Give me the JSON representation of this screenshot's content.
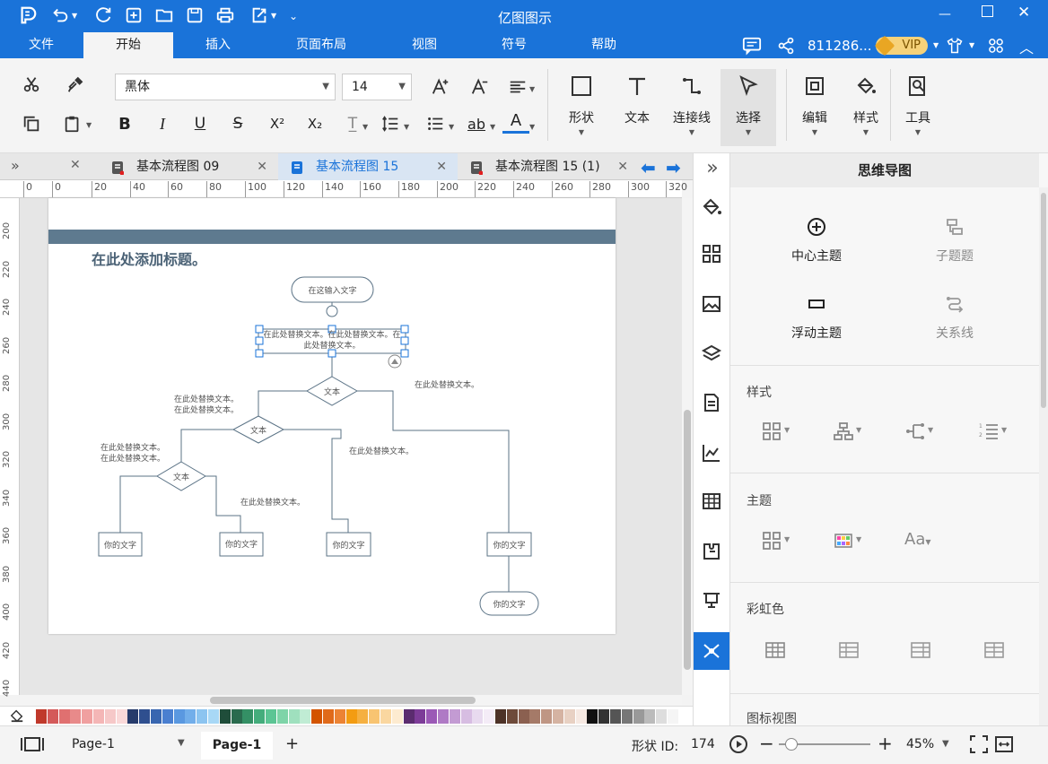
{
  "window": {
    "title": "亿图图示"
  },
  "menu": [
    "文件",
    "开始",
    "插入",
    "页面布局",
    "视图",
    "符号",
    "帮助"
  ],
  "user": {
    "id": "811286...",
    "vip": "VIP"
  },
  "ribbon": {
    "font": "黑体",
    "size": "14",
    "tools": {
      "shape": "形状",
      "text": "文本",
      "connector": "连接线",
      "select": "选择",
      "edit": "编辑",
      "style": "样式",
      "tool": "工具"
    }
  },
  "tabs": [
    {
      "label": "基本流程图 09",
      "active": false
    },
    {
      "label": "基本流程图 15",
      "active": true
    },
    {
      "label": "基本流程图 15 (1)",
      "active": false
    }
  ],
  "ruler": {
    "h": [
      "0",
      "0",
      "20",
      "40",
      "60",
      "80",
      "100",
      "120",
      "140",
      "160",
      "180",
      "200",
      "220",
      "240",
      "260",
      "280",
      "300",
      "320"
    ],
    "v": [
      "200",
      "220",
      "240",
      "260",
      "280",
      "300",
      "320",
      "340",
      "360",
      "380",
      "400",
      "420",
      "440"
    ]
  },
  "canvas": {
    "title": "在此处添加标题。",
    "start": "在这输入文字",
    "process": "在此处替换文本。在此处替换文本。在此处替换文本。",
    "decision": "文本",
    "note_right": "在此处替换文本。",
    "note_left1": "在此处替换文本。在此处替换文本。",
    "note_left2": "在此处替换文本。在此处替换文本。",
    "note_mid": "在此处替换文本。",
    "note_mid2": "在此处替换文本。",
    "box": "你的文字",
    "end": "你的文字"
  },
  "panel": {
    "title": "思维导图",
    "center_topic": "中心主题",
    "sub_topic": "子题题",
    "float_topic": "浮动主题",
    "relation": "关系线",
    "section_style": "样式",
    "section_theme": "主题",
    "section_rainbow": "彩虹色",
    "section_iconview": "图标视图"
  },
  "status": {
    "page_tab": "Page-1",
    "page_tab_bold": "Page-1",
    "shape_id_label": "形状 ID:",
    "shape_id": "174",
    "zoom": "45%"
  },
  "colors": {
    "accent": "#1a73d9",
    "header_band": "#5e7a8f"
  }
}
